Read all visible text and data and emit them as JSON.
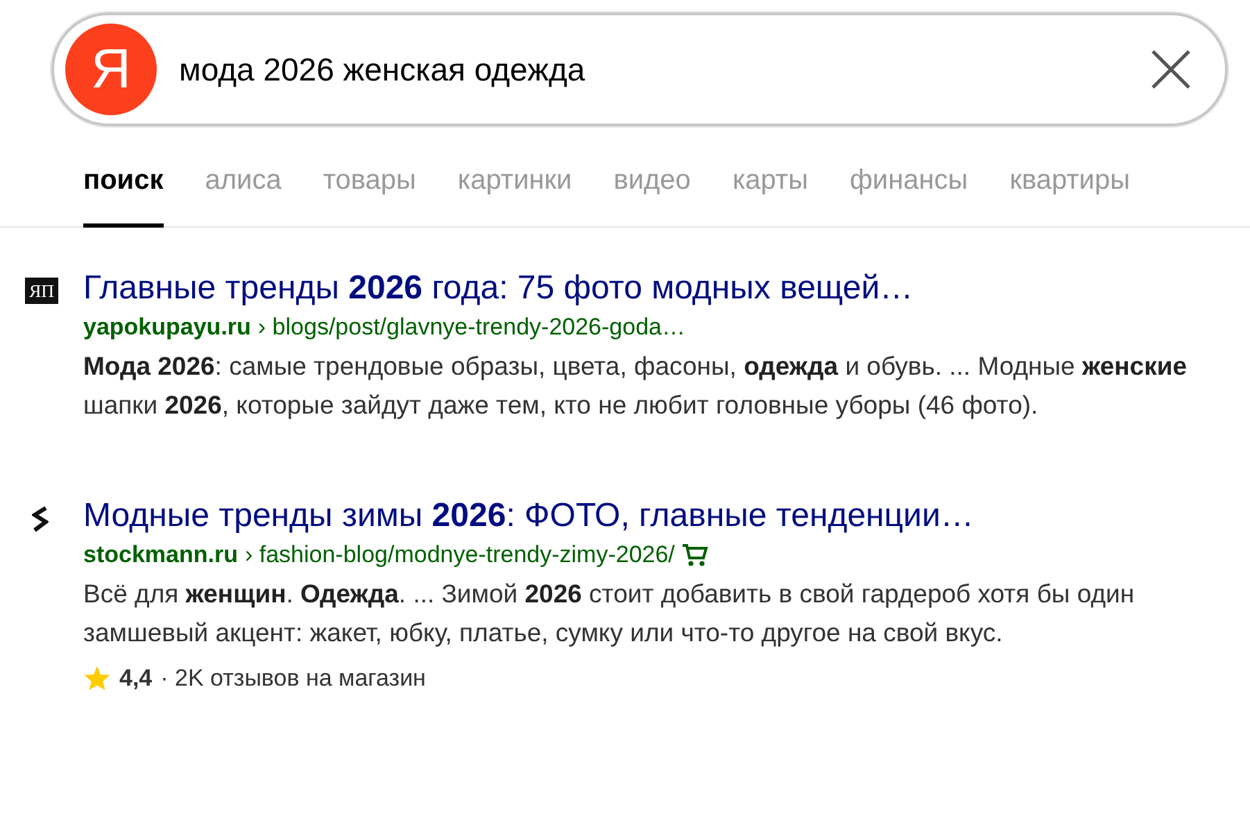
{
  "search": {
    "logo": "Я",
    "query": "мода 2026 женская одежда"
  },
  "tabs": [
    {
      "label": "поиск",
      "selected": true
    },
    {
      "label": "алиса",
      "selected": false
    },
    {
      "label": "товары",
      "selected": false
    },
    {
      "label": "картинки",
      "selected": false
    },
    {
      "label": "видео",
      "selected": false
    },
    {
      "label": "карты",
      "selected": false
    },
    {
      "label": "финансы",
      "selected": false
    },
    {
      "label": "квартиры",
      "selected": false
    }
  ],
  "results": [
    {
      "favicon_text": "ЯП",
      "title": "Главные тренды **2026** года: 75 фото модных вещей…",
      "domain": "yapokupayu.ru",
      "path": "› blogs/post/glavnye-trendy-2026-goda…",
      "shop": false,
      "snippet": "**Мода 2026**: самые трендовые образы, цвета, фасоны, **одежда** и обувь. ... Модные **женские** шапки **2026**, которые зайдут даже тем, кто не любит головные уборы (46 фото)."
    },
    {
      "title": "Модные тренды зимы **2026**: ФОТО, главные тенденции…",
      "domain": "stockmann.ru",
      "path": "› fashion-blog/modnye-trendy-zimy-2026/",
      "shop": true,
      "snippet": "Всё для **женщин**. **Одежда**. ... Зимой **2026** стоит добавить в свой гардероб хотя бы один замшевый акцент: жакет, юбку, платье, сумку или что-то другое на свой вкус.",
      "rating": "4,4",
      "reviews": "· 2K отзывов на магазин"
    }
  ]
}
